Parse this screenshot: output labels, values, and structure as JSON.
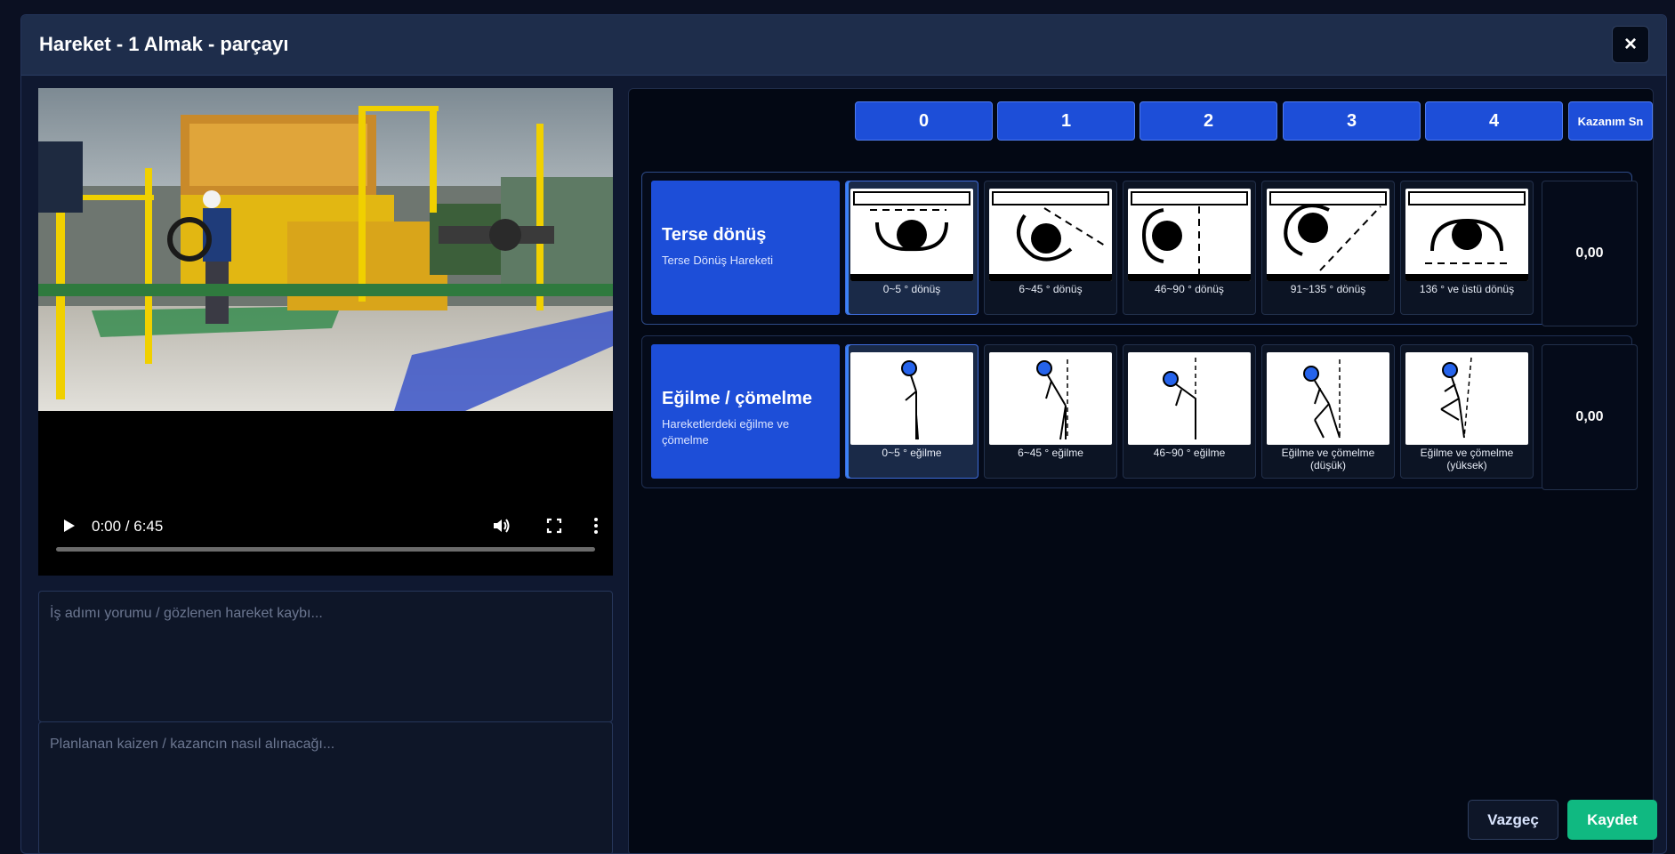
{
  "modal": {
    "title": "Hareket - 1 Almak - parçayı",
    "close_label": "×"
  },
  "video": {
    "time": "0:00 / 6:45",
    "progress": 0
  },
  "notes": {
    "comment_placeholder": "İş adımı yorumu / gözlenen hareket kaybı...",
    "kaizen_placeholder": "Planlanan kaizen / kazancın nasıl alınacağı..."
  },
  "scores": [
    "0",
    "1",
    "2",
    "3",
    "4"
  ],
  "kazanim_header": "Kazanım Sn",
  "rows": [
    {
      "title": "Terse dönüş",
      "subtitle": "Terse Dönüş Hareketi",
      "options": [
        {
          "label": "0~5 ° dönüş",
          "icon": "turn-0-5-icon"
        },
        {
          "label": "6~45 ° dönüş",
          "icon": "turn-6-45-icon"
        },
        {
          "label": "46~90 ° dönüş",
          "icon": "turn-46-90-icon"
        },
        {
          "label": "91~135 ° dönüş",
          "icon": "turn-91-135-icon"
        },
        {
          "label": "136 ° ve üstü dönüş",
          "icon": "turn-136-plus-icon"
        }
      ],
      "selected": 0,
      "kazanim": "0,00"
    },
    {
      "title": "Eğilme / çömelme",
      "subtitle": "Hareketlerdeki eğilme ve çömelme",
      "options": [
        {
          "label": "0~5 ° eğilme",
          "icon": "bend-0-5-icon"
        },
        {
          "label": "6~45 ° eğilme",
          "icon": "bend-6-45-icon"
        },
        {
          "label": "46~90 ° eğilme",
          "icon": "bend-46-90-icon"
        },
        {
          "label": "Eğilme ve çömelme (düşük)",
          "icon": "squat-low-icon"
        },
        {
          "label": "Eğilme ve çömelme (yüksek)",
          "icon": "squat-high-icon"
        }
      ],
      "selected": 0,
      "kazanim": "0,00"
    }
  ],
  "buttons": {
    "cancel": "Vazgeç",
    "save": "Kaydet"
  },
  "colors": {
    "accent": "#1d4ed8",
    "save": "#10b981",
    "background": "#0b1022"
  }
}
